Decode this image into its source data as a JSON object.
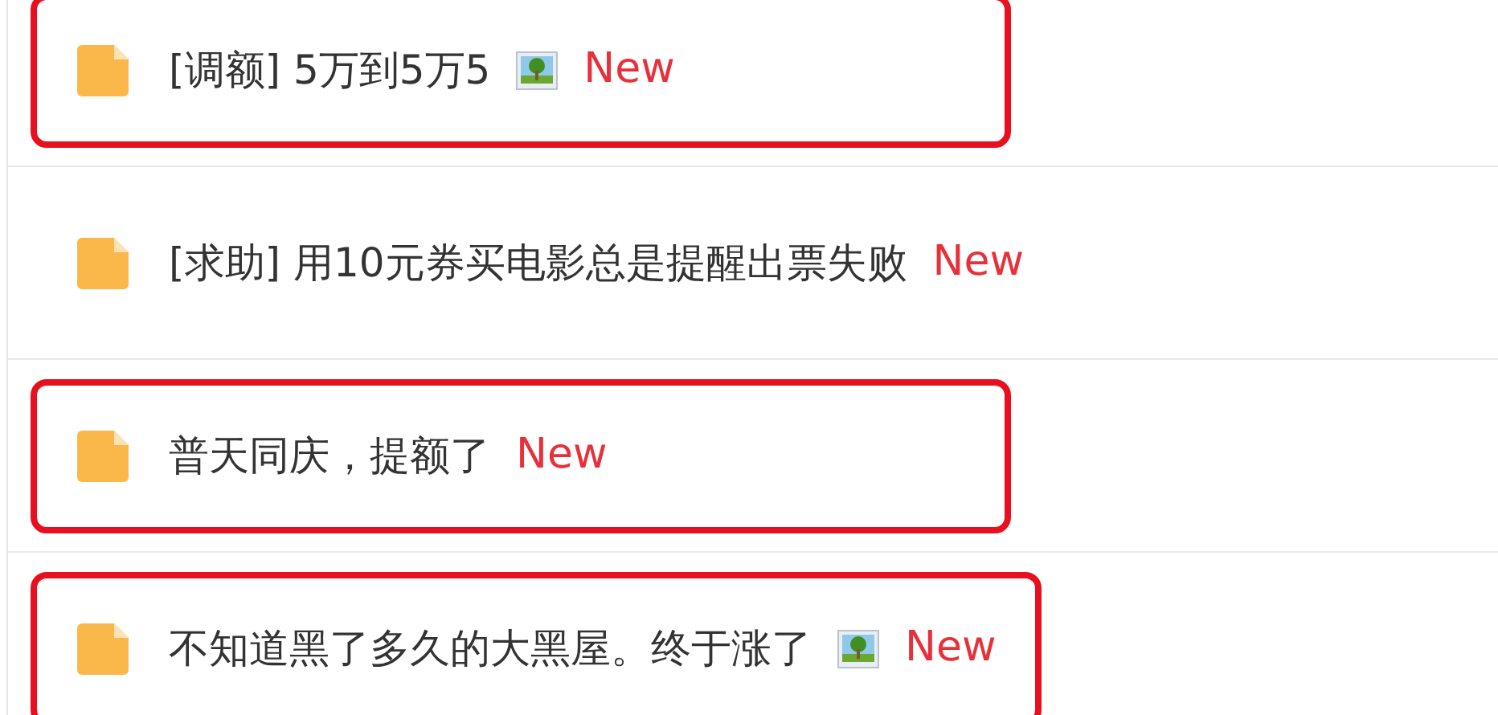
{
  "threads": [
    {
      "title": "[调额] 5万到5万5",
      "has_image": true,
      "badge": "New",
      "highlighted": true
    },
    {
      "title": "[求助] 用10元券买电影总是提醒出票失败",
      "has_image": false,
      "badge": "New",
      "highlighted": false
    },
    {
      "title": "普天同庆，提额了",
      "has_image": false,
      "badge": "New",
      "highlighted": true
    },
    {
      "title": "不知道黑了多久的大黑屋。终于涨了",
      "has_image": true,
      "badge": "New",
      "highlighted": true
    }
  ]
}
